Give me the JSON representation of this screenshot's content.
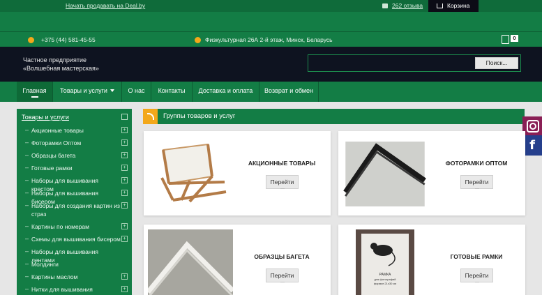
{
  "topbar": {
    "sell_link": "Начать продавать на Deal.by",
    "reviews_link": "262 отзыва",
    "cart_label": "Корзина"
  },
  "contact": {
    "phone": "+375 (44) 581-45-55",
    "address": "Физкультурная 26А 2-й этаж, Минск, Беларусь",
    "cart_count": "0"
  },
  "header": {
    "company_line1": "Частное предприятие",
    "company_line2": "«Волшебная мастерская»",
    "search_placeholder": "",
    "search_button": "Поиск..."
  },
  "nav": {
    "items": [
      "Главная",
      "Товары и услуги",
      "О нас",
      "Контакты",
      "Доставка и оплата",
      "Возврат и обмен"
    ]
  },
  "sidebar": {
    "title": "Товары и услуги",
    "items": [
      "Акционные товары",
      "Фоторамки Оптом",
      "Образцы багета",
      "Готовые рамки",
      "Наборы для вышивания крестом",
      "Наборы для вышивания бисером",
      "Наборы для создания картин из страз",
      "Картины по номерам",
      "Схемы для вышивания бисером",
      "Наборы для вышивания лентами",
      "Молдинги",
      "Картины маслом",
      "Нитки для вышивания"
    ]
  },
  "main": {
    "heading": "Группы товаров и услуг",
    "go_label": "Перейти",
    "cards": [
      {
        "name": "АКЦИОННЫЕ ТОВАРЫ"
      },
      {
        "name": "ФОТОРАМКИ ОПТОМ"
      },
      {
        "name": "ОБРАЗЦЫ БАГЕТА"
      },
      {
        "name": "ГОТОВЫЕ РАМКИ"
      }
    ],
    "frame_caption_1": "РАМКА",
    "frame_caption_2": "для фотографий",
    "frame_caption_3": "формат 21х30 см"
  },
  "colors": {
    "green": "#137d45",
    "dark": "#0e1320",
    "accent": "#f3a81a"
  }
}
